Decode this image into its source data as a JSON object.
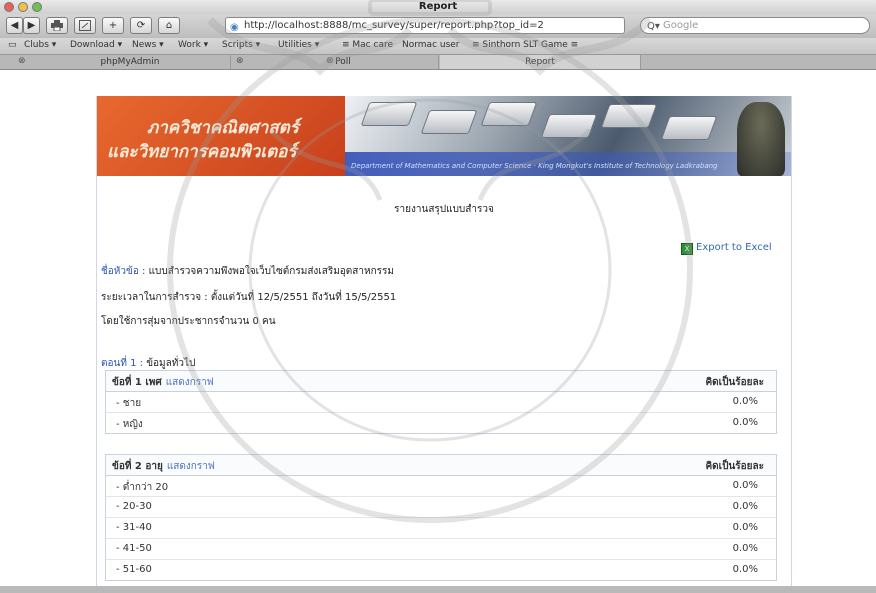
{
  "window": {
    "title": "Report"
  },
  "toolbar": {
    "url": "http://localhost:8888/mc_survey/super/report.php?top_id=2",
    "search_placeholder": "Google",
    "nav_back": "◀",
    "nav_forward": "▶",
    "print_icon": "printer-icon",
    "add_icon": "+",
    "reload_icon": "⟳",
    "home_icon": "⌂"
  },
  "bookmarks": [
    "Clubs ▾",
    "Download ▾",
    "News ▾",
    "Work ▾",
    "Scripts ▾",
    "Utilities ▾",
    "≡ Mac care",
    "Normac user",
    "≡ Sinthorn SLT Game ≡"
  ],
  "tabs": [
    {
      "label": "phpMyAdmin"
    },
    {
      "label": "Poll"
    },
    {
      "label": "Report"
    }
  ],
  "page": {
    "banner_line1": "ภาควิชาคณิตศาสตร์",
    "banner_line2": "และวิทยาการคอมพิวเตอร์",
    "banner_tagline": "Department of Mathematics and Computer Science · King Mongkut's Institute of Technology Ladkrabang",
    "title": "รายงานสรุปแบบสำรวจ",
    "export_label": "Export to Excel",
    "topic_label": "ชื่อหัวข้อ :",
    "topic_value": "แบบสำรวจความพึงพอใจเว็บไซต์กรมส่งเสริมอุตสาหกรรม",
    "period_label": "ระยะเวลาในการสำรวจ :",
    "period_value": "ตั้งแต่วันที่ 12/5/2551 ถึงวันที่ 15/5/2551",
    "sample_text": "โดยใช้การสุ่มจากประชากรจำนวน 0 คน",
    "section_label": "ตอนที่ 1 :",
    "section_value": "ข้อมูลทั่วไป"
  },
  "questions": [
    {
      "title": "ข้อที่ 1 เพศ",
      "graph_link": "แสดงกราฟ",
      "pct_header": "คิดเป็นร้อยละ",
      "options": [
        {
          "label": "- ชาย",
          "value": "0.0%"
        },
        {
          "label": "- หญิง",
          "value": "0.0%"
        }
      ]
    },
    {
      "title": "ข้อที่ 2 อายุ",
      "graph_link": "แสดงกราฟ",
      "pct_header": "คิดเป็นร้อยละ",
      "options": [
        {
          "label": "- ต่ำกว่า 20",
          "value": "0.0%"
        },
        {
          "label": "- 20-30",
          "value": "0.0%"
        },
        {
          "label": "- 31-40",
          "value": "0.0%"
        },
        {
          "label": "- 41-50",
          "value": "0.0%"
        },
        {
          "label": "- 51-60",
          "value": "0.0%"
        }
      ]
    }
  ],
  "watermark": {
    "text": "มหาวิทยาลัยศรีนครินทรวิโรฒ",
    "lower_text": "ร่มเกล้าเจ้าฯ"
  },
  "colors": {
    "banner_orange": "#e05a2a",
    "link_blue": "#3568b8",
    "table_border": "#c9d1dc"
  }
}
